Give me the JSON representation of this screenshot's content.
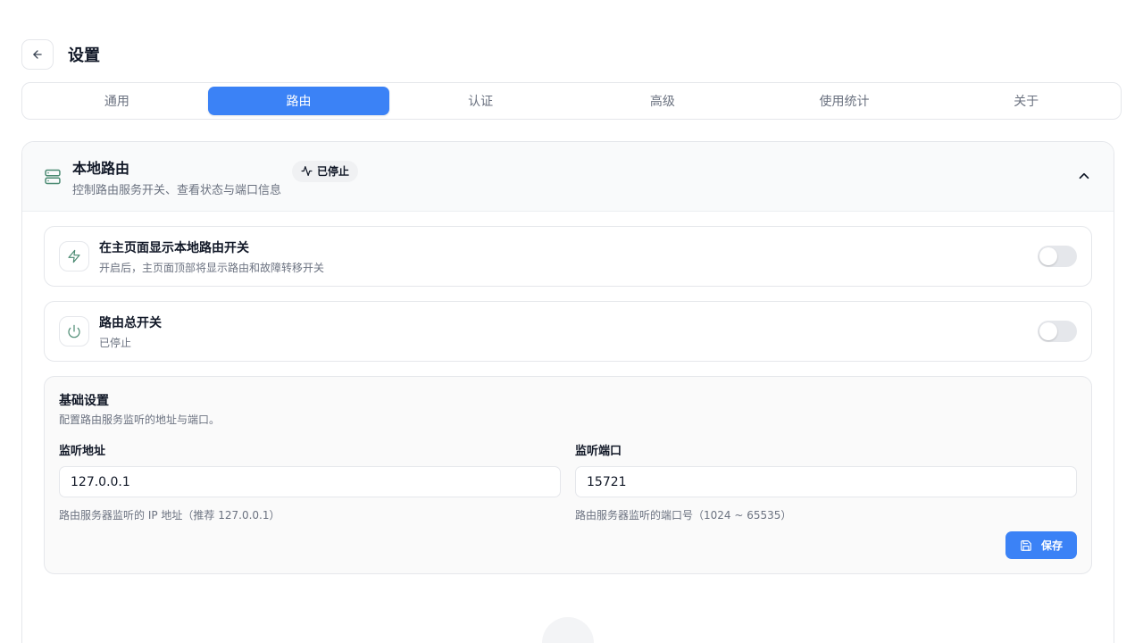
{
  "header": {
    "back_icon": "arrow-left-icon",
    "title": "设置"
  },
  "tabs": [
    {
      "label": "通用",
      "active": false
    },
    {
      "label": "路由",
      "active": true
    },
    {
      "label": "认证",
      "active": false
    },
    {
      "label": "高级",
      "active": false
    },
    {
      "label": "使用统计",
      "active": false
    },
    {
      "label": "关于",
      "active": false
    }
  ],
  "local_router": {
    "icon": "server-icon",
    "title": "本地路由",
    "subtitle": "控制路由服务开关、查看状态与端口信息",
    "status": {
      "icon": "activity-icon",
      "label": "已停止"
    },
    "collapse_icon": "chevron-up-icon"
  },
  "rows": [
    {
      "icon": "zap-icon",
      "title": "在主页面显示本地路由开关",
      "desc": "开启后，主页面顶部将显示路由和故障转移开关",
      "enabled": false
    },
    {
      "icon": "power-icon",
      "title": "路由总开关",
      "desc": "已停止",
      "enabled": false
    }
  ],
  "basic": {
    "title": "基础设置",
    "desc": "配置路由服务监听的地址与端口。",
    "address": {
      "label": "监听地址",
      "value": "127.0.0.1",
      "hint": "路由服务器监听的 IP 地址（推荐 127.0.0.1）"
    },
    "port": {
      "label": "监听端口",
      "value": "15721",
      "hint": "路由服务器监听的端口号（1024 ~ 65535）"
    },
    "save": {
      "icon": "save-icon",
      "label": "保存"
    }
  },
  "colors": {
    "accent": "#3b82f6",
    "icon_green": "#4b8a72",
    "border": "#e5e7eb"
  }
}
